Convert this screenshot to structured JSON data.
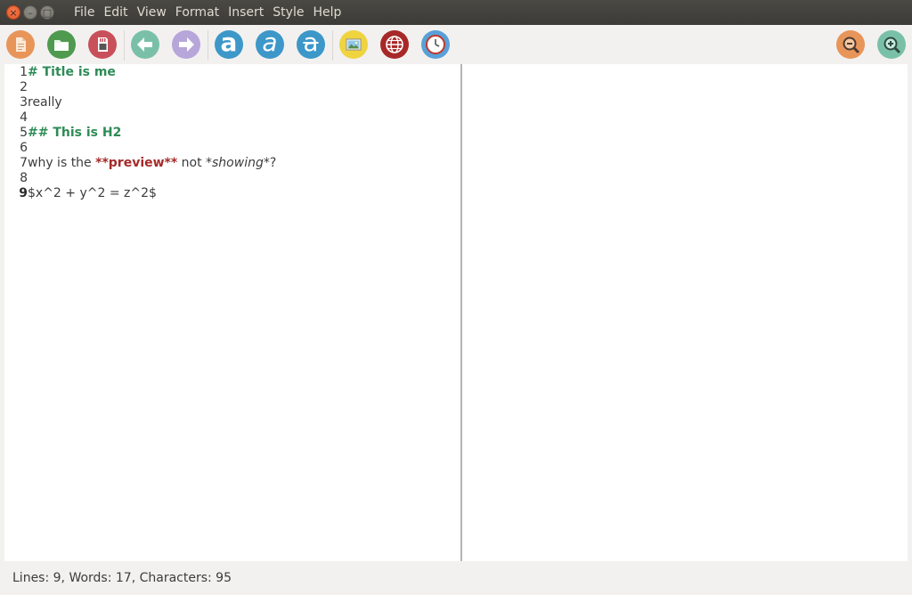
{
  "window": {
    "close_glyph": "×",
    "min_glyph": "–",
    "max_glyph": "□"
  },
  "menu": [
    "File",
    "Edit",
    "View",
    "Format",
    "Insert",
    "Style",
    "Help"
  ],
  "toolbar": {
    "icons": [
      {
        "name": "new-document-icon",
        "color": "#e8955a"
      },
      {
        "name": "open-folder-icon",
        "color": "#4f9a4f"
      },
      {
        "name": "save-sd-icon",
        "color": "#c8505a"
      },
      {
        "name": "undo-arrow-icon",
        "color": "#7ac0a8"
      },
      {
        "name": "redo-arrow-icon",
        "color": "#b7a6da"
      },
      {
        "name": "bold-icon",
        "color": "#3d97c9",
        "glyph": "a"
      },
      {
        "name": "italic-icon",
        "color": "#3d97c9",
        "glyph": "a"
      },
      {
        "name": "strikethrough-icon",
        "color": "#3d97c9",
        "glyph": "a"
      },
      {
        "name": "insert-image-icon",
        "color": "#efd440"
      },
      {
        "name": "insert-link-globe-icon",
        "color": "#a82828"
      },
      {
        "name": "insert-timestamp-clock-icon",
        "color": "#5aa0d8"
      },
      {
        "name": "zoom-out-icon",
        "color": "#e8955a"
      },
      {
        "name": "zoom-in-icon",
        "color": "#7ac0a8"
      }
    ]
  },
  "editor": {
    "lines": [
      {
        "num": "1",
        "parts": [
          {
            "text": "# Title is me",
            "style": "heading"
          }
        ]
      },
      {
        "num": "2",
        "parts": []
      },
      {
        "num": "3",
        "parts": [
          {
            "text": "really",
            "style": "plain"
          }
        ]
      },
      {
        "num": "4",
        "parts": []
      },
      {
        "num": "5",
        "parts": [
          {
            "text": "## This is H2",
            "style": "heading"
          }
        ]
      },
      {
        "num": "6",
        "parts": []
      },
      {
        "num": "7",
        "parts": [
          {
            "text": "why is the ",
            "style": "plain"
          },
          {
            "text": "**preview**",
            "style": "bold-md"
          },
          {
            "text": " not *",
            "style": "plain"
          },
          {
            "text": "showing",
            "style": "ital-md"
          },
          {
            "text": "*?",
            "style": "plain"
          }
        ]
      },
      {
        "num": "8",
        "parts": []
      },
      {
        "num": "9",
        "parts": [
          {
            "text": "$x^2 + y^2 = z^2$",
            "style": "plain"
          }
        ],
        "current": true
      }
    ]
  },
  "status": {
    "text": "Lines: 9, Words: 17, Characters: 95"
  }
}
